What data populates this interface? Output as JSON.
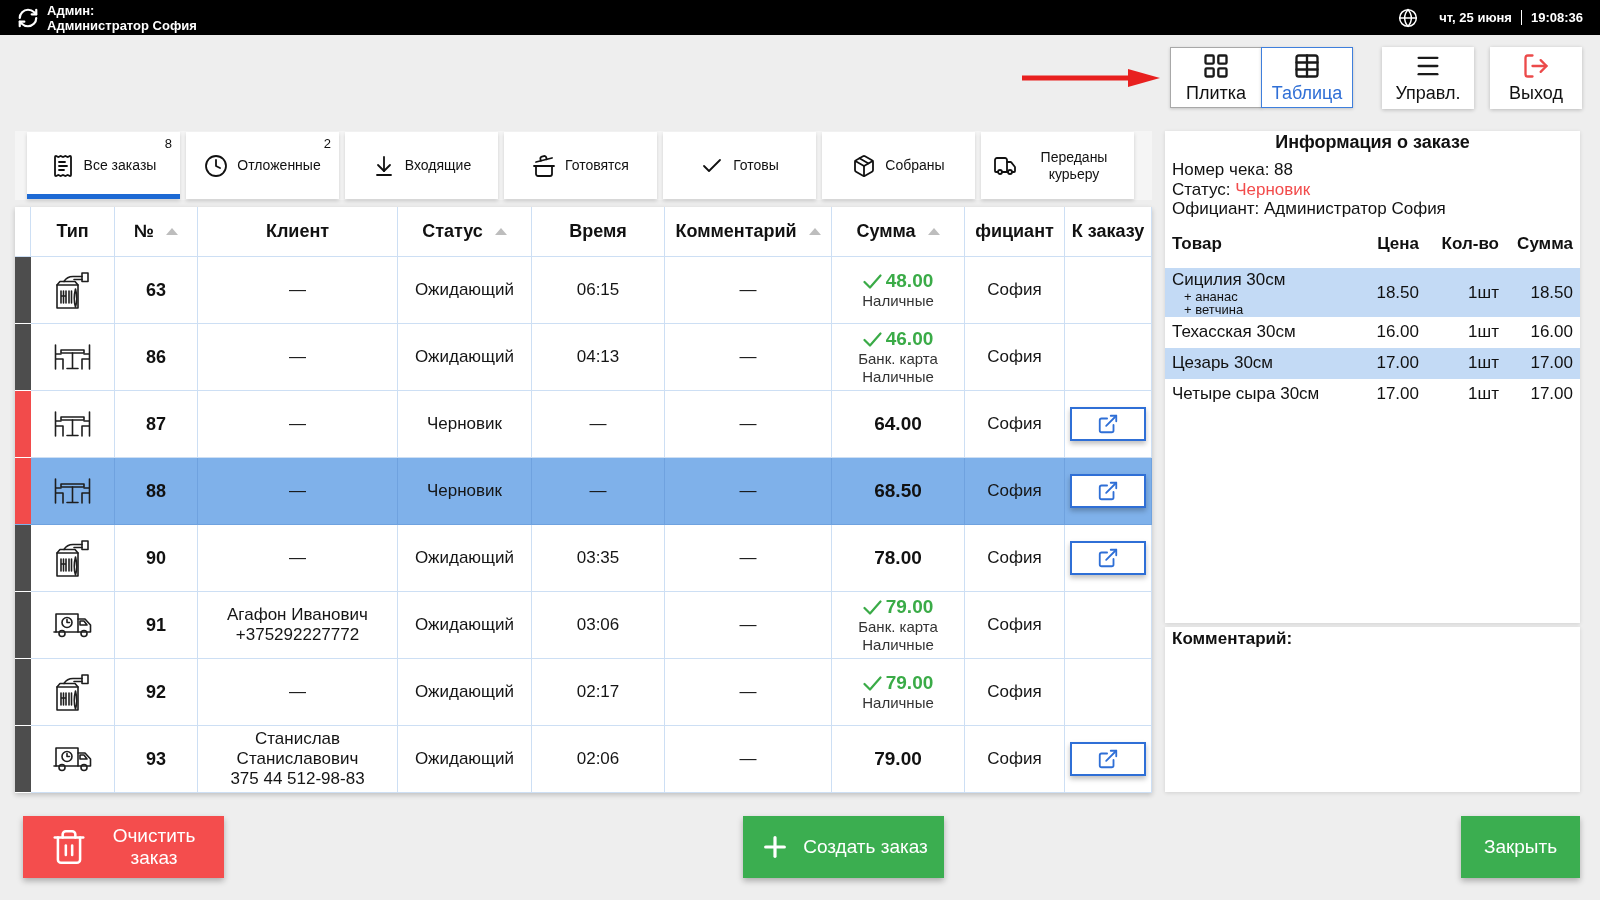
{
  "top_bar": {
    "user_role": "Админ:",
    "user_name": "Администратор София",
    "date": "чт, 25 июня",
    "time": "19:08:36"
  },
  "view_toggle": [
    {
      "label": "Плитка",
      "selected": false
    },
    {
      "label": "Таблица",
      "selected": true
    }
  ],
  "nav_buttons": [
    "Управл.",
    "Выход"
  ],
  "tabs": [
    {
      "label": "Все заказы",
      "badge": "8",
      "selected": true
    },
    {
      "label": "Отложенные",
      "badge": "2",
      "selected": false
    },
    {
      "label": "Входящие",
      "selected": false
    },
    {
      "label": "Готовятся",
      "selected": false
    },
    {
      "label": "Готовы",
      "selected": false
    },
    {
      "label": "Собраны",
      "selected": false
    },
    {
      "label": "Переданы курьеру",
      "selected": false
    }
  ],
  "table": {
    "columns": [
      {
        "label": "Тип",
        "sortable": false
      },
      {
        "label": "№",
        "sortable": true
      },
      {
        "label": "Клиент",
        "sortable": false
      },
      {
        "label": "Статус",
        "sortable": true
      },
      {
        "label": "Время",
        "sortable": false
      },
      {
        "label": "Комментарий",
        "sortable": true
      },
      {
        "label": "Сумма",
        "sortable": true
      },
      {
        "label": "фициант",
        "sortable": false
      },
      {
        "label": "К заказу",
        "sortable": false
      }
    ],
    "rows": [
      {
        "color": "#4d4d4d",
        "selected": false,
        "kind": "takeaway",
        "number": "63",
        "client": "—",
        "status": "Ожидающий",
        "time": "06:15",
        "comment": "—",
        "amount": "48.00",
        "paid": true,
        "payments": [
          "Наличные"
        ],
        "waiter": "София",
        "open_button": false
      },
      {
        "color": "#4d4d4d",
        "selected": false,
        "kind": "dine_in",
        "number": "86",
        "client": "—",
        "status": "Ожидающий",
        "time": "04:13",
        "comment": "—",
        "amount": "46.00",
        "paid": true,
        "payments": [
          "Банк. карта",
          "Наличные"
        ],
        "waiter": "София",
        "open_button": false
      },
      {
        "color": "#f24b4b",
        "selected": false,
        "kind": "dine_in",
        "number": "87",
        "client": "—",
        "status": "Черновик",
        "time": "—",
        "comment": "—",
        "amount": "64.00",
        "paid": false,
        "waiter": "София",
        "open_button": true
      },
      {
        "color": "#f24b4b",
        "selected": true,
        "kind": "dine_in",
        "number": "88",
        "client": "—",
        "status": "Черновик",
        "time": "—",
        "comment": "—",
        "amount": "68.50",
        "paid": false,
        "waiter": "София",
        "open_button": true
      },
      {
        "color": "#4d4d4d",
        "selected": false,
        "kind": "takeaway",
        "number": "90",
        "client": "—",
        "status": "Ожидающий",
        "time": "03:35",
        "comment": "—",
        "amount": "78.00",
        "paid": false,
        "waiter": "София",
        "open_button": true
      },
      {
        "color": "#4d4d4d",
        "selected": false,
        "kind": "delivery",
        "number": "91",
        "client": "Агафон Иванович",
        "phone": "+375292227772",
        "status": "Ожидающий",
        "time": "03:06",
        "comment": "—",
        "amount": "79.00",
        "paid": true,
        "payments": [
          "Банк. карта",
          "Наличные"
        ],
        "waiter": "София",
        "open_button": false
      },
      {
        "color": "#4d4d4d",
        "selected": false,
        "kind": "takeaway",
        "number": "92",
        "client": "—",
        "status": "Ожидающий",
        "time": "02:17",
        "comment": "—",
        "amount": "79.00",
        "paid": true,
        "payments": [
          "Наличные"
        ],
        "waiter": "София",
        "open_button": false
      },
      {
        "color": "#4d4d4d",
        "selected": false,
        "kind": "delivery",
        "number": "93",
        "client": "Станислав Станиславович",
        "phone": "375 44 512-98-83",
        "status": "Ожидающий",
        "time": "02:06",
        "comment": "—",
        "amount": "79.00",
        "paid": false,
        "waiter": "София",
        "open_button": true
      }
    ]
  },
  "order_info": {
    "title": "Информация о заказе",
    "fields": [
      {
        "label": "Номер чека:",
        "value": "88",
        "warning": false
      },
      {
        "label": "Статус:",
        "value": "Черновик",
        "warning": true
      },
      {
        "label": "Официант:",
        "value": "Администратор София",
        "warning": false
      }
    ],
    "item_columns": [
      "Товар",
      "Цена",
      "Кол-во",
      "Сумма"
    ],
    "items": [
      {
        "name": "Сицилия 30см",
        "modifiers": [
          "+ ананас",
          "+ ветчина"
        ],
        "price": "18.50",
        "qty": "1шт",
        "total": "18.50"
      },
      {
        "name": "Техасская 30см",
        "price": "16.00",
        "qty": "1шт",
        "total": "16.00"
      },
      {
        "name": "Цезарь 30см",
        "price": "17.00",
        "qty": "1шт",
        "total": "17.00"
      },
      {
        "name": "Четыре сыра 30см",
        "price": "17.00",
        "qty": "1шт",
        "total": "17.00"
      }
    ]
  },
  "comment": {
    "label": "Комментарий:"
  },
  "actions": {
    "clear": "Очистить заказ",
    "create": "Создать заказ",
    "close": "Закрыть"
  }
}
